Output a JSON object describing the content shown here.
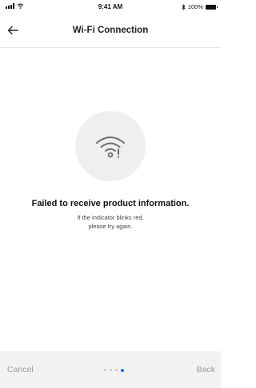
{
  "status_bar": {
    "time": "9:41 AM",
    "battery_text": "100%",
    "icons": [
      "signal-icon",
      "wifi-icon",
      "bluetooth-icon",
      "battery-icon"
    ]
  },
  "nav": {
    "title": "Wi-Fi Connection",
    "back_icon": "back-arrow-icon"
  },
  "main": {
    "icon": "wifi-error-icon",
    "headline": "Failed to receive product information.",
    "subtext_line1": "If the indicator blinks red,",
    "subtext_line2": "please try again."
  },
  "footer": {
    "cancel_label": "Cancel",
    "back_label": "Back",
    "step_total": 4,
    "step_current": 4
  },
  "colors": {
    "accent": "#1e73e8",
    "footer_bg": "#f2f2f2",
    "icon_circle": "#efefef"
  }
}
